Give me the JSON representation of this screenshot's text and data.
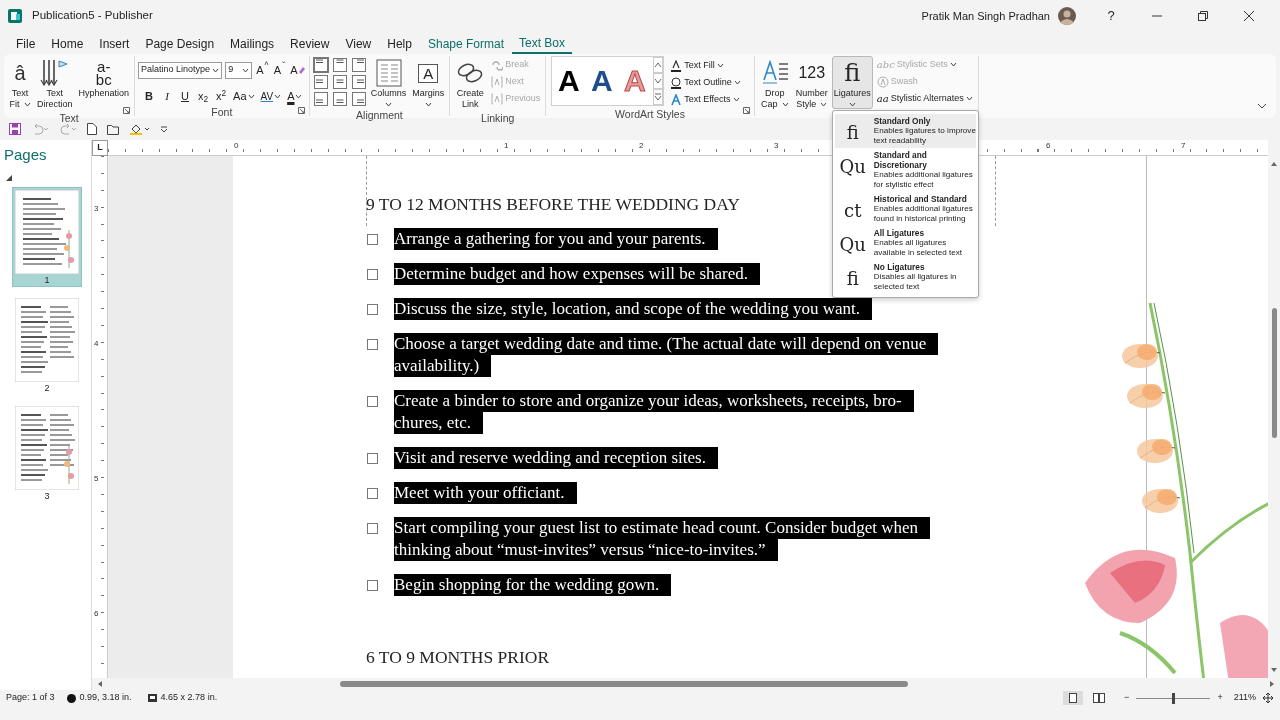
{
  "window": {
    "title": "Publication5  -  Publisher",
    "user": "Pratik Man Singh Pradhan",
    "help": "?"
  },
  "menu_tabs": [
    {
      "label": "File",
      "kind": "plain",
      "selected": false
    },
    {
      "label": "Home",
      "kind": "plain",
      "selected": false
    },
    {
      "label": "Insert",
      "kind": "plain",
      "selected": false
    },
    {
      "label": "Page Design",
      "kind": "plain",
      "selected": false
    },
    {
      "label": "Mailings",
      "kind": "plain",
      "selected": false
    },
    {
      "label": "Review",
      "kind": "plain",
      "selected": false
    },
    {
      "label": "View",
      "kind": "plain",
      "selected": false
    },
    {
      "label": "Help",
      "kind": "plain",
      "selected": false
    },
    {
      "label": "Shape Format",
      "kind": "contextual",
      "selected": false
    },
    {
      "label": "Text Box",
      "kind": "contextual",
      "selected": true
    }
  ],
  "ribbon": {
    "text": {
      "label": "Text",
      "buttons": [
        {
          "lines": [
            "Text",
            "Fit"
          ],
          "kind": "textfit",
          "glyph": "â",
          "dropdown": true
        },
        {
          "lines": [
            "Text",
            "Direction"
          ],
          "kind": "direction",
          "dropdown": false
        },
        {
          "lines": [
            "Hyphenation"
          ],
          "kind": "hyphen",
          "glyph": "a-\nbc",
          "dropdown": false
        }
      ]
    },
    "font": {
      "label": "Font",
      "font_name": "Palatino Linotype",
      "font_size": "9",
      "size_buttons": [
        "A$^{^}$",
        "A$^{ˇ}$"
      ],
      "clear_button": "A",
      "format_buttons": [
        {
          "text": "B",
          "kind": "bold",
          "dropdown": false
        },
        {
          "text": "I",
          "kind": "italic",
          "dropdown": false
        },
        {
          "text": "U",
          "kind": "underline",
          "dropdown": false
        },
        {
          "text": "x$_{2}$",
          "kind": "plain",
          "dropdown": false
        },
        {
          "text": "x$^{2}$",
          "kind": "plain",
          "dropdown": false
        },
        {
          "text": "Aa",
          "kind": "plain",
          "dropdown": true
        },
        {
          "text": "AV",
          "kind": "spacing",
          "dropdown": true
        },
        {
          "text": "A",
          "kind": "color",
          "dropdown": true
        }
      ]
    },
    "alignment": {
      "label": "Alignment",
      "options": [
        {
          "selected": true
        },
        {
          "selected": false
        },
        {
          "selected": false
        },
        {
          "selected": false
        },
        {
          "selected": false
        },
        {
          "selected": false
        },
        {
          "selected": false
        },
        {
          "selected": false
        },
        {
          "selected": false
        }
      ],
      "buttons": [
        {
          "lines": [
            "Columns"
          ],
          "kind": "columns",
          "dropdown": true
        },
        {
          "lines": [
            "Margins"
          ],
          "kind": "margins",
          "glyph": "A",
          "dropdown": true
        }
      ]
    },
    "linking": {
      "label": "Linking",
      "create": {
        "lines": [
          "Create",
          "Link"
        ],
        "kind": "link",
        "dropdown": false
      },
      "items": [
        {
          "label": "Break",
          "kind": "break",
          "disabled": true
        },
        {
          "label": "Next",
          "kind": "next",
          "disabled": true
        },
        {
          "label": "Previous",
          "kind": "previous",
          "disabled": true
        }
      ]
    },
    "wordart": {
      "label": "WordArt Styles",
      "styles": [
        {
          "letter": "A",
          "kind": "black"
        },
        {
          "letter": "A",
          "kind": "blue"
        },
        {
          "letter": "A",
          "kind": "outline"
        }
      ],
      "items": [
        {
          "label": "Text Fill",
          "kind": "fill",
          "disabled": false,
          "dropdown": true
        },
        {
          "label": "Text Outline",
          "kind": "outline",
          "disabled": false,
          "dropdown": true
        },
        {
          "label": "Text Effects",
          "kind": "effects",
          "disabled": false,
          "dropdown": true
        }
      ]
    },
    "typography": {
      "buttons": [
        {
          "lines": [
            "Drop",
            "Cap"
          ],
          "kind": "dropcap",
          "dropdown": true,
          "expanded": false
        },
        {
          "lines": [
            "Number",
            "Style"
          ],
          "kind": "number",
          "glyph": "123",
          "dropdown": true,
          "expanded": false
        },
        {
          "lines": [
            "Ligatures"
          ],
          "kind": "ligatures",
          "glyph": "fi",
          "dropdown": true,
          "expanded": true
        }
      ],
      "items": [
        {
          "label": "Stylistic Sets",
          "kind": "sets",
          "glyph": "abc",
          "disabled": true,
          "dropdown": true
        },
        {
          "label": "Swash",
          "kind": "swash",
          "disabled": true,
          "dropdown": false
        },
        {
          "label": "Stylistic Alternates",
          "kind": "alternates",
          "glyph": "aa",
          "disabled": false,
          "dropdown": true
        }
      ]
    }
  },
  "ligatures_menu": {
    "items": [
      {
        "sample": "fi",
        "title": "Standard Only",
        "description": [
          "Enables ligatures to improve",
          "text readability"
        ],
        "selected": true
      },
      {
        "sample": "Qu",
        "title": "Standard and Discretionary",
        "description": [
          "Enables additional ligatures",
          "for stylistic effect"
        ],
        "selected": false
      },
      {
        "sample": "ct",
        "title": "Historical and Standard",
        "description": [
          "Enables additional ligatures",
          "found in historical printing"
        ],
        "selected": false
      },
      {
        "sample": "Qu",
        "title": "All Ligatures",
        "description": [
          "Enables all ligatures",
          "available in selected text"
        ],
        "selected": false
      },
      {
        "sample": "fi",
        "title": "No Ligatures",
        "description": [
          "Disables all ligatures in",
          "selected text"
        ],
        "selected": false
      }
    ]
  },
  "pages_pane": {
    "title": "Pages",
    "pages": [
      {
        "number": "1",
        "selected": true
      },
      {
        "number": "2",
        "selected": false
      },
      {
        "number": "3",
        "selected": false
      }
    ]
  },
  "rulers": {
    "tab_selector": "L",
    "horizontal": [
      "0",
      "1",
      "2",
      "3",
      "6",
      "7"
    ],
    "vertical": [
      "3",
      "4",
      "5",
      "6"
    ]
  },
  "document": {
    "heading": "9 TO 12 MONTHS BEFORE THE WEDDING DAY",
    "items": [
      {
        "lines": [
          "Arrange a gathering for you and your parents."
        ],
        "checked": false,
        "selected": true
      },
      {
        "lines": [
          "Determine budget and how expenses will be shared."
        ],
        "checked": false,
        "selected": true
      },
      {
        "lines": [
          "Discuss the size, style, location, and scope of the wedding you want."
        ],
        "checked": false,
        "selected": true
      },
      {
        "lines": [
          "Choose a target wedding date and time. (The actual date will depend on venue",
          "availability.)"
        ],
        "checked": false,
        "selected": true
      },
      {
        "lines": [
          "Create a binder to store and organize your ideas, worksheets, receipts, bro-",
          "chures, etc."
        ],
        "checked": false,
        "selected": true
      },
      {
        "lines": [
          "Visit and reserve wedding and reception sites."
        ],
        "checked": false,
        "selected": true
      },
      {
        "lines": [
          "Meet with your officiant."
        ],
        "checked": false,
        "selected": true
      },
      {
        "lines": [
          "Start compiling your guest list to estimate head count. Consider budget when",
          "thinking about “must-invites” versus “nice-to-invites.”"
        ],
        "checked": false,
        "selected": true
      },
      {
        "lines": [
          "Begin shopping for the wedding gown."
        ],
        "checked": false,
        "selected": true
      }
    ],
    "next_heading": "6 TO 9 MONTHS PRIOR"
  },
  "status_bar": {
    "page": "Page: 1 of 3",
    "position": "0.99, 3.18 in.",
    "size": "4.65 x 2.78 in.",
    "views": [
      {
        "selected": true
      },
      {
        "selected": false
      }
    ],
    "zoom_out": "−",
    "zoom_slider": {
      "level": 0.5
    },
    "zoom_in": "+",
    "zoom": "211%"
  }
}
